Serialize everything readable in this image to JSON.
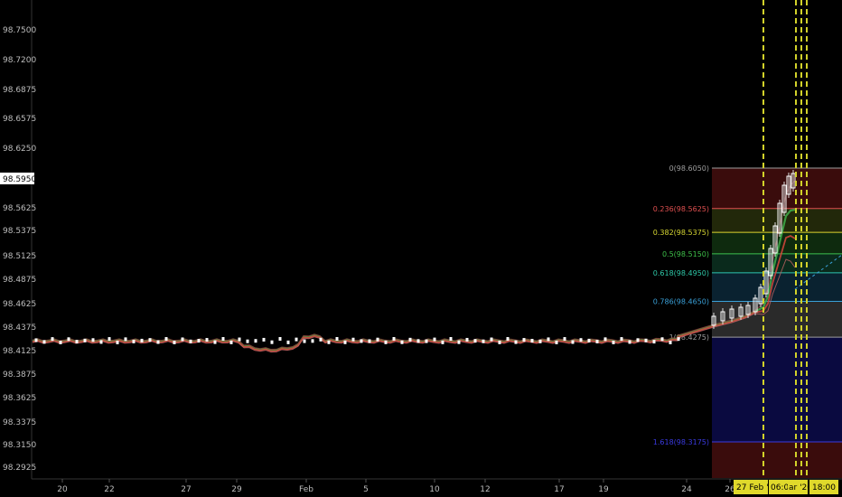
{
  "colors": {
    "background": "#000000",
    "axis_text": "#bdbdbd",
    "price_up": "#ffffff",
    "ema_red": "#d8463c",
    "ema_green": "#3fae4a",
    "session_line": "#d2d22a",
    "time_highlight": "#e0d92b"
  },
  "y_axis": {
    "ticks": [
      "98.7500",
      "98.7200",
      "98.6875",
      "98.6575",
      "98.6250",
      "98.5950",
      "98.5625",
      "98.5375",
      "98.5125",
      "98.4875",
      "98.4625",
      "98.4375",
      "98.4125",
      "98.3875",
      "98.3625",
      "98.3375",
      "98.3150",
      "98.2925"
    ],
    "current_price": "98.5950"
  },
  "x_axis": {
    "ticks": [
      "20",
      "22",
      "27",
      "29",
      "Feb",
      "5",
      "10",
      "12",
      "17",
      "19",
      "24",
      "26"
    ],
    "highlights": [
      "27 Feb '20",
      "06:00",
      "ar '20",
      "18:00"
    ]
  },
  "fibonacci": [
    {
      "label": "0(98.6050)",
      "value": 98.605,
      "color": "#9e9e9e"
    },
    {
      "label": "0.236(98.5625)",
      "value": 98.5625,
      "color": "#e05050"
    },
    {
      "label": "0.382(98.5375)",
      "value": 98.5375,
      "color": "#d6d632"
    },
    {
      "label": "0.5(98.5150)",
      "value": 98.515,
      "color": "#3ec04a"
    },
    {
      "label": "0.618(98.4950)",
      "value": 98.495,
      "color": "#2ec8a8"
    },
    {
      "label": "0.786(98.4650)",
      "value": 98.465,
      "color": "#3aa0d8"
    },
    {
      "label": "1(98.4275)",
      "value": 98.4275,
      "color": "#9e9e9e"
    },
    {
      "label": "1.618(98.3175)",
      "value": 98.3175,
      "color": "#3a3ae0"
    }
  ]
}
